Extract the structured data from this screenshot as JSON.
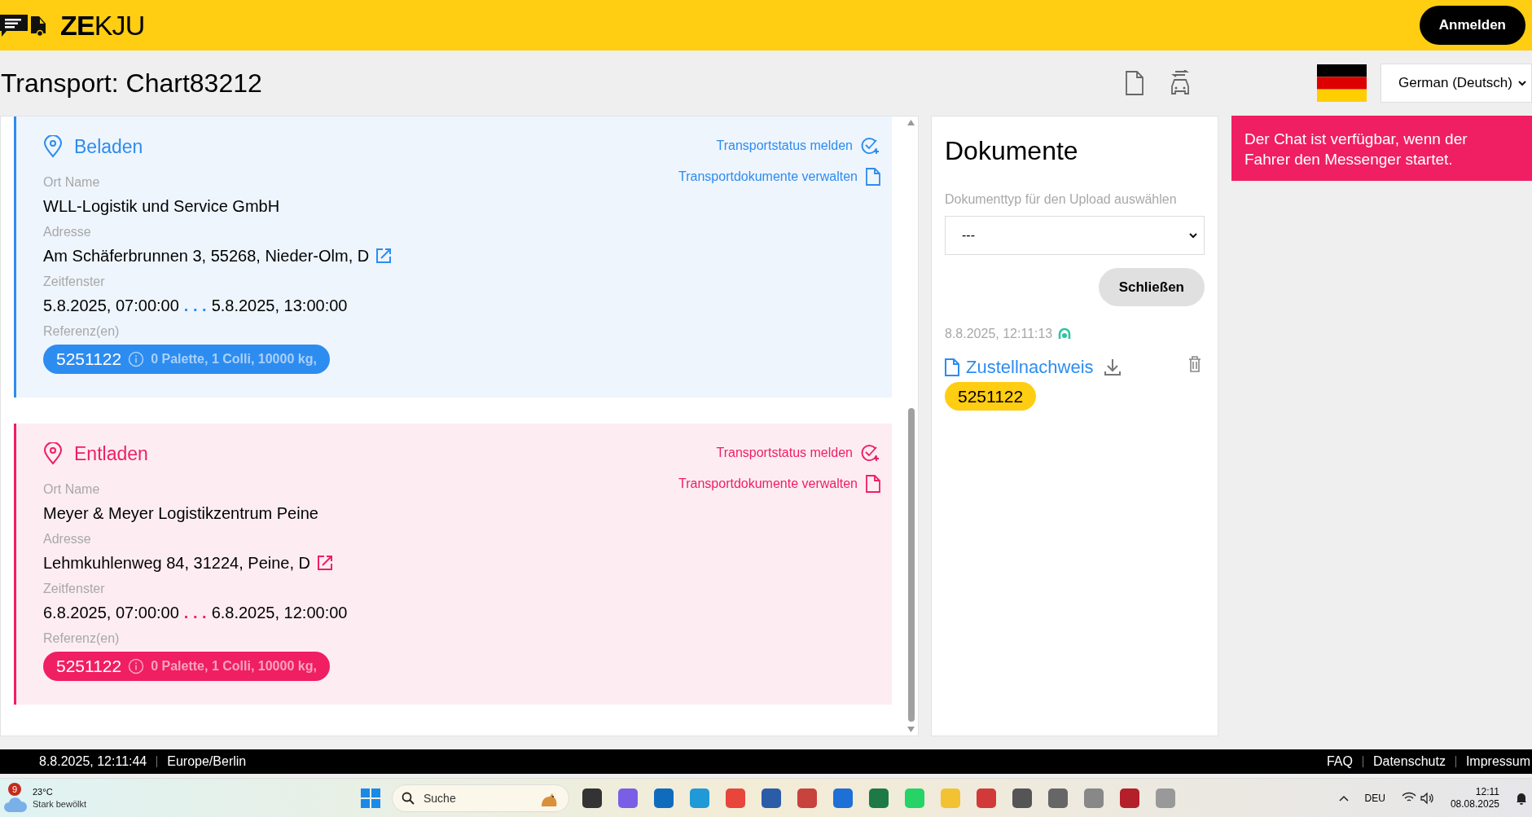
{
  "header": {
    "logo_text": "**ZE**KJU",
    "login_button": "Anmelden"
  },
  "title": "Transport: Chart83212",
  "language": {
    "value": "German (Deutsch)"
  },
  "stops": [
    {
      "kind": "load",
      "title": "Beladen",
      "actions": [
        "Transportstatus melden",
        "Transportdokumente verwalten"
      ],
      "fields": [
        {
          "kind": "text",
          "label": "Ort Name",
          "value": "WLL-Logistik und Service GmbH"
        },
        {
          "kind": "address",
          "label": "Adresse",
          "value": "Am Schäferbrunnen 3, 55268, Nieder-Olm, D"
        },
        {
          "kind": "window",
          "label": "Zeitfenster",
          "from": "5.8.2025, 07:00:00",
          "separator": ". . .",
          "to": "5.8.2025, 13:00:00"
        },
        {
          "kind": "reference",
          "label": "Referenz(en)",
          "number": "5251122",
          "info": "0 Palette, 1 Colli, 10000 kg,"
        }
      ]
    },
    {
      "kind": "unload",
      "title": "Entladen",
      "actions": [
        "Transportstatus melden",
        "Transportdokumente verwalten"
      ],
      "fields": [
        {
          "kind": "text",
          "label": "Ort Name",
          "value": "Meyer & Meyer Logistikzentrum Peine"
        },
        {
          "kind": "address",
          "label": "Adresse",
          "value": "Lehmkuhlenweg 84, 31224, Peine, D"
        },
        {
          "kind": "window",
          "label": "Zeitfenster",
          "from": "6.8.2025, 07:00:00",
          "separator": ". . .",
          "to": "6.8.2025, 12:00:00"
        },
        {
          "kind": "reference",
          "label": "Referenz(en)",
          "number": "5251122",
          "info": "0 Palette, 1 Colli, 10000 kg,"
        }
      ]
    }
  ],
  "documents": {
    "title": "Dokumente",
    "upload_label": "Dokumenttyp für den Upload auswählen",
    "upload_select": "---",
    "close_button": "Schließen",
    "entries": [
      {
        "timestamp": "8.8.2025, 12:11:13",
        "name": "Zustellnachweis",
        "tag": "5251122"
      }
    ]
  },
  "chat_notice": "Der Chat ist verfügbar, wenn der Fahrer den Messenger startet.",
  "footer": {
    "datetime": "8.8.2025, 12:11:44",
    "timezone": "Europe/Berlin",
    "links": [
      "FAQ",
      "Datenschutz",
      "Impressum"
    ]
  },
  "taskbar": {
    "weather": {
      "badge": "9",
      "temperature": "23°C",
      "condition": "Stark bewölkt"
    },
    "search": {
      "placeholder": "Suche"
    },
    "tray": {
      "language": "DEU",
      "time": "12:11",
      "date": "08.08.2025"
    }
  }
}
